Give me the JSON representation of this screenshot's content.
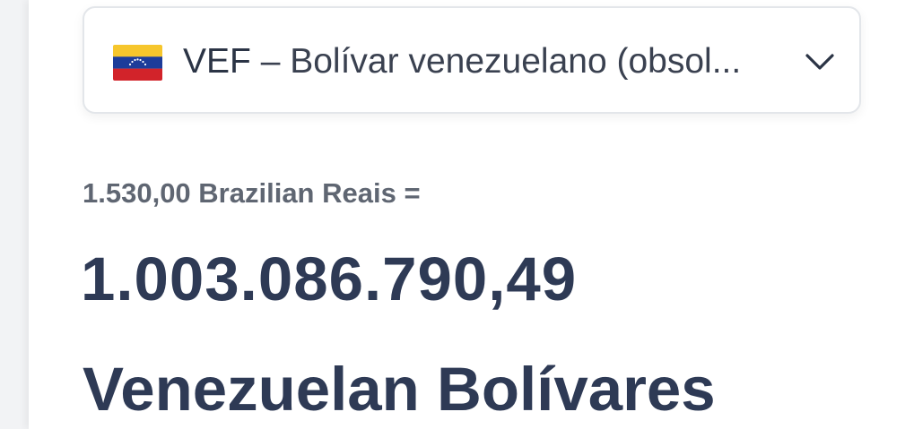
{
  "currency_select": {
    "code": "VEF",
    "separator": " – ",
    "name": "Bolívar venezuelano (obsol...",
    "flag_icon": "venezuela-flag-icon",
    "chevron_icon": "chevron-down-icon",
    "flag_colors": {
      "yellow": "#f6c62c",
      "blue": "#1c3c9a",
      "red": "#d2232a",
      "stars": "#ffffff"
    }
  },
  "conversion": {
    "from_text": "1.530,00 Brazilian Reais =",
    "result_amount": "1.003.086.790,49",
    "result_currency": "Venezuelan Bolívares"
  },
  "colors": {
    "heading": "#2e3a55",
    "subtle": "#5f6672",
    "border": "#e3e6ea"
  }
}
